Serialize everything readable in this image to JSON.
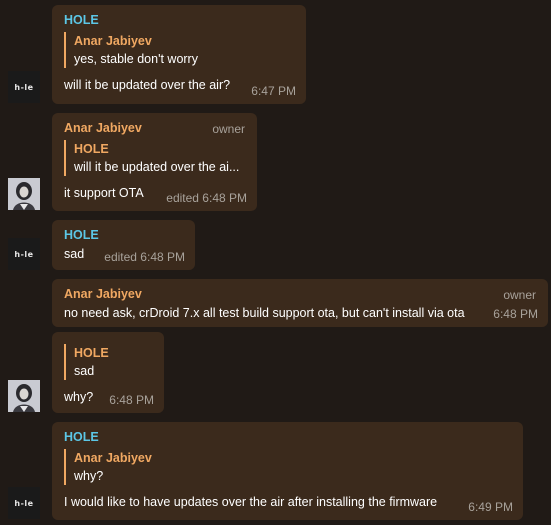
{
  "messages": [
    {
      "sender": "HOLE",
      "reply": {
        "name": "Anar Jabiyev",
        "text": "yes, stable don't worry"
      },
      "text": "will it be updated over the air?",
      "meta": "6:47 PM"
    },
    {
      "sender": "Anar Jabiyev",
      "role": "owner",
      "reply": {
        "name": "HOLE",
        "text": "will it be updated over the ai..."
      },
      "text": "it support OTA",
      "meta": "edited 6:48 PM"
    },
    {
      "sender": "HOLE",
      "text": "sad",
      "meta": "edited 6:48 PM"
    },
    {
      "sender": "Anar Jabiyev",
      "role": "owner",
      "text": "no need ask, crDroid 7.x all test build support ota, but can't install via ota",
      "meta": "6:48 PM"
    },
    {
      "reply": {
        "name": "HOLE",
        "text": "sad"
      },
      "text": "why?",
      "meta": "6:48 PM"
    },
    {
      "sender": "HOLE",
      "reply": {
        "name": "Anar Jabiyev",
        "text": "why?"
      },
      "text": "I would like to have updates over the air after installing the firmware",
      "meta": "6:49 PM"
    }
  ],
  "avatars": {
    "hole_label": "h-le"
  }
}
